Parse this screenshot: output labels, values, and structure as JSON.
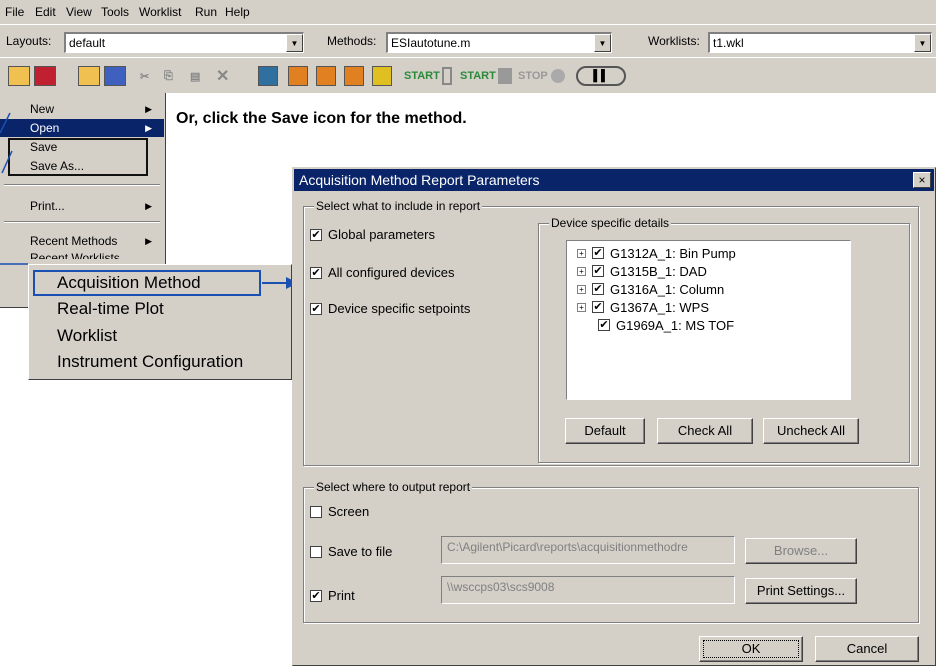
{
  "menubar": [
    "File",
    "Edit",
    "View",
    "Tools",
    "Worklist",
    "Run",
    "Help"
  ],
  "selectors": {
    "layouts_label": "Layouts:",
    "layouts_value": "default",
    "methods_label": "Methods:",
    "methods_value": "ESIautotune.m",
    "worklists_label": "Worklists:",
    "worklists_value": "t1.wkl"
  },
  "toolbar": {
    "start1": "START",
    "start2": "START",
    "stop": "STOP"
  },
  "file_menu": [
    "New",
    "Open",
    "Save",
    "Save As...",
    "Print...",
    "Recent Methods",
    "Recent Worklists"
  ],
  "submenu": [
    "Acquisition Method",
    "Real-time Plot",
    "Worklist",
    "Instrument Configuration"
  ],
  "instruction": "Or, click the Save icon for the method.",
  "dialog": {
    "title": "Acquisition Method Report Parameters",
    "close": "×",
    "include_group": "Select what to include in report",
    "opt_global": "Global parameters",
    "opt_devices": "All configured devices",
    "opt_setpoints": "Device specific setpoints",
    "details_group": "Device specific details",
    "devices": [
      "G1312A_1:  Bin Pump",
      "G1315B_1:  DAD",
      "G1316A_1:  Column",
      "G1367A_1:  WPS",
      "G1969A_1:  MS TOF"
    ],
    "btn_default": "Default",
    "btn_check_all": "Check All",
    "btn_uncheck_all": "Uncheck All",
    "output_group": "Select where to output report",
    "opt_screen": "Screen",
    "opt_save_file": "Save to file",
    "save_path": "C:\\Agilent\\Picard\\reports\\acquisitionmethodre",
    "btn_browse": "Browse...",
    "opt_print": "Print",
    "print_path": "\\\\wsccps03\\scs9008",
    "btn_print_settings": "Print Settings...",
    "btn_ok": "OK",
    "btn_cancel": "Cancel"
  }
}
